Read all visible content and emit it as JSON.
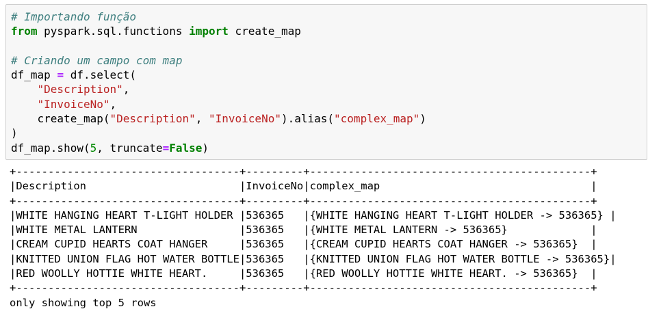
{
  "code": {
    "comment1": "# Importando função",
    "import_kw_from": "from",
    "import_module": " pyspark.sql.functions ",
    "import_kw_import": "import",
    "import_name": " create_map",
    "comment2": "# Criando um campo com map",
    "select_prefix": "df_map ",
    "assign_op": "=",
    "select_call": " df.select(",
    "arg_indent": "    ",
    "arg1": "\"Description\"",
    "arg2": "\"InvoiceNo\"",
    "comma": ",",
    "map_call": "create_map(",
    "map_arg1": "\"Description\"",
    "map_sep": ", ",
    "map_arg2": "\"InvoiceNo\"",
    "alias_call": ").alias(",
    "alias_arg": "\"complex_map\"",
    "alias_close": ")",
    "close_paren": ")",
    "show_prefix": "df_map.show(",
    "show_num": "5",
    "show_mid": ", truncate",
    "show_eq": "=",
    "show_false": "False",
    "show_close": ")"
  },
  "output": {
    "border": "+-----------------------------------+---------+--------------------------------------------+",
    "header": "|Description                        |InvoiceNo|complex_map                                 |",
    "rows": [
      "|WHITE HANGING HEART T-LIGHT HOLDER |536365   |{WHITE HANGING HEART T-LIGHT HOLDER -> 536365} |",
      "|WHITE METAL LANTERN                |536365   |{WHITE METAL LANTERN -> 536365}             |",
      "|CREAM CUPID HEARTS COAT HANGER     |536365   |{CREAM CUPID HEARTS COAT HANGER -> 536365}  |",
      "|KNITTED UNION FLAG HOT WATER BOTTLE|536365   |{KNITTED UNION FLAG HOT WATER BOTTLE -> 536365}|",
      "|RED WOOLLY HOTTIE WHITE HEART.     |536365   |{RED WOOLLY HOTTIE WHITE HEART. -> 536365}  |"
    ],
    "footer_note": "only showing top 5 rows"
  },
  "colors": {
    "cell_bg": "#f7f7f7",
    "comment": "#408080",
    "keyword": "#008000",
    "string": "#ba2121",
    "operator": "#aa22ff"
  }
}
